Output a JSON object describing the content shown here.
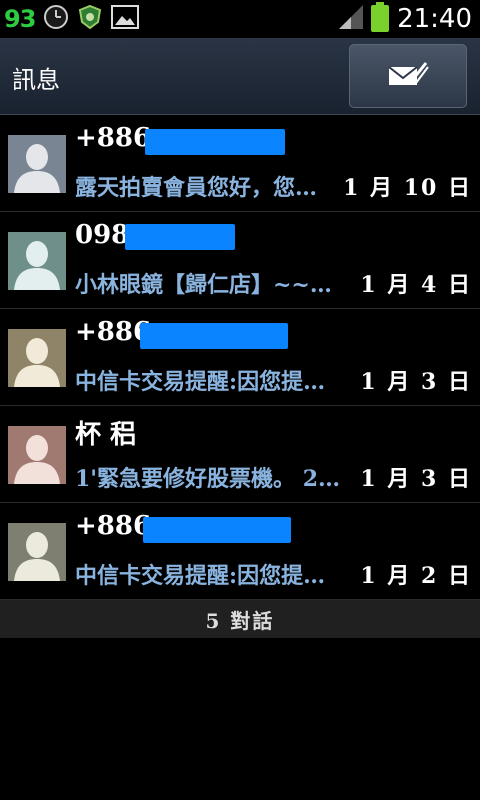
{
  "status_bar": {
    "battery_percent": "93",
    "time": "21:40",
    "icons": [
      "clock-icon",
      "shield-icon",
      "image-icon",
      "signal-icon",
      "battery-icon"
    ]
  },
  "header": {
    "title": "訊息",
    "compose_icon": "compose-message-icon"
  },
  "conversations": [
    {
      "name": "+886",
      "preview": "露天拍賣會員您好，您…",
      "date": "1 月 10 日",
      "avatar_color": "#7a8593"
    },
    {
      "name": "098",
      "preview": "小林眼鏡【歸仁店】~~…",
      "date": "1 月 4 日",
      "avatar_color": "#6e8f8a"
    },
    {
      "name": "+886",
      "preview": "中信卡交易提醒:因您提…",
      "date": "1 月 3 日",
      "avatar_color": "#8f8467"
    },
    {
      "name": "杯 稆",
      "preview": "1'緊急要修好股票機。 2…",
      "date": "1 月 3 日",
      "avatar_color": "#a07a70"
    },
    {
      "name": "+886",
      "preview": "中信卡交易提醒:因您提…",
      "date": "1 月 2 日",
      "avatar_color": "#7e7f70"
    }
  ],
  "footer": {
    "count_label": "5 對話"
  },
  "colors": {
    "redaction": "#0a84ff",
    "preview_text": "#8ab4e0",
    "battery": "#2ecc40"
  }
}
